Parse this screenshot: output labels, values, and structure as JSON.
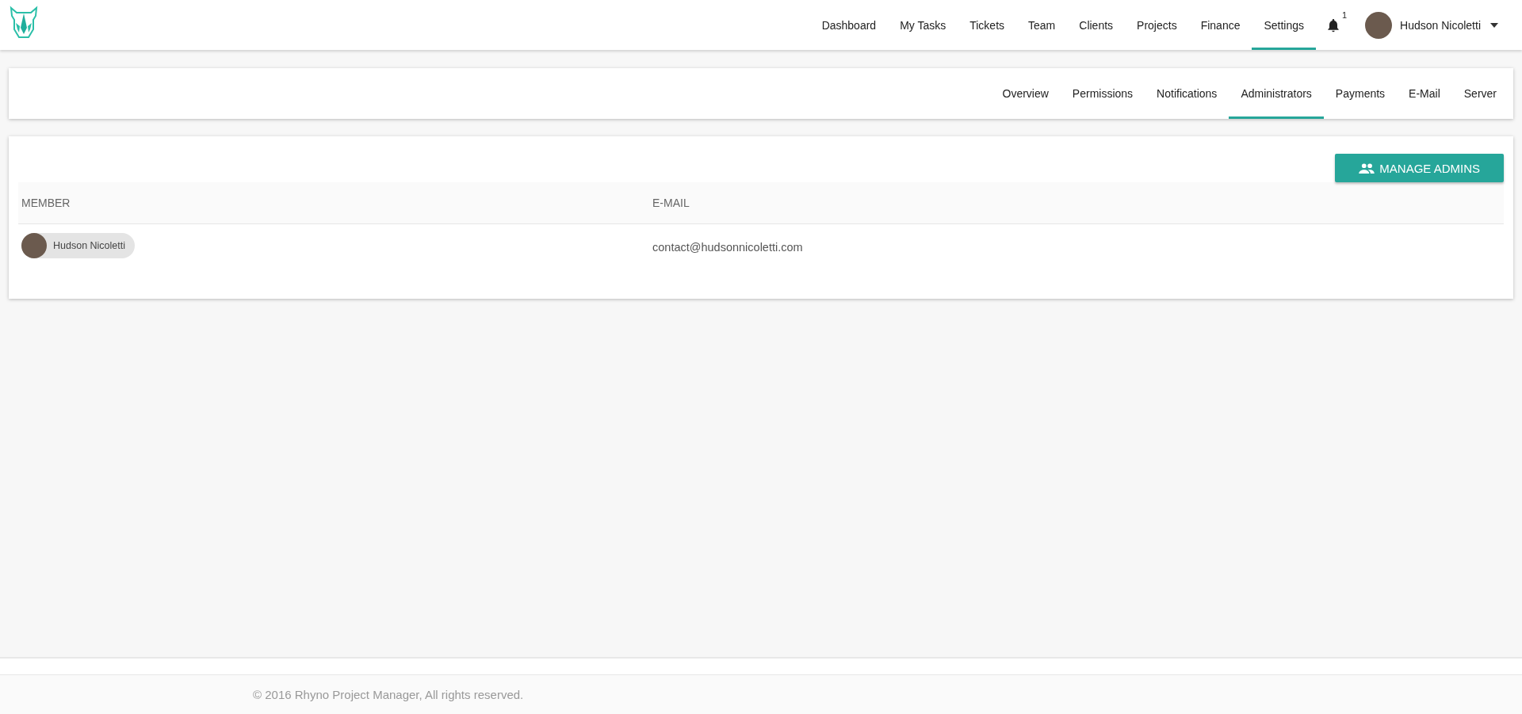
{
  "nav": [
    {
      "label": "Dashboard",
      "selected": false
    },
    {
      "label": "My Tasks",
      "selected": false
    },
    {
      "label": "Tickets",
      "selected": false
    },
    {
      "label": "Team",
      "selected": false
    },
    {
      "label": "Clients",
      "selected": false
    },
    {
      "label": "Projects",
      "selected": false
    },
    {
      "label": "Finance",
      "selected": false
    },
    {
      "label": "Settings",
      "selected": true
    }
  ],
  "notifications": {
    "count": "1"
  },
  "user": {
    "name": "Hudson Nicoletti"
  },
  "subnav": [
    {
      "label": "Overview",
      "selected": false
    },
    {
      "label": "Permissions",
      "selected": false
    },
    {
      "label": "Notifications",
      "selected": false
    },
    {
      "label": "Administrators",
      "selected": true
    },
    {
      "label": "Payments",
      "selected": false
    },
    {
      "label": "E-Mail",
      "selected": false
    },
    {
      "label": "Server",
      "selected": false
    }
  ],
  "manage_button": "MANAGE ADMINS",
  "table": {
    "columns": [
      "MEMBER",
      "E-MAIL"
    ],
    "rows": [
      {
        "member": "Hudson Nicoletti",
        "email": "contact@hudsonnicoletti.com"
      }
    ]
  },
  "footer": "© 2016 Rhyno Project Manager, All rights reserved."
}
